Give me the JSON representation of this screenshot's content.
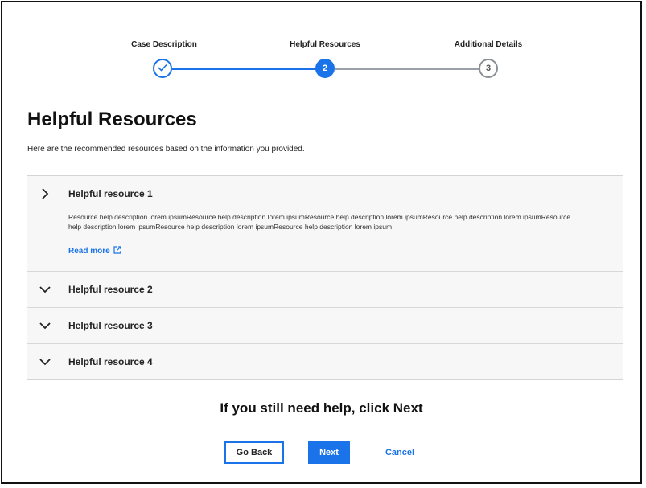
{
  "stepper": {
    "steps": [
      {
        "label": "Case Description",
        "state": "complete",
        "icon": "check-icon"
      },
      {
        "label": "Helpful Resources",
        "state": "active",
        "number": "2"
      },
      {
        "label": "Additional Details",
        "state": "upcoming",
        "number": "3"
      }
    ]
  },
  "page": {
    "title": "Helpful Resources",
    "intro": "Here are the recommended resources based on the information you provided."
  },
  "accordion": {
    "items": [
      {
        "title": "Helpful resource 1",
        "expanded": true,
        "chevron": "chevron-right-icon",
        "description": "Resource help description lorem ipsumResource help description lorem ipsumResource help description lorem ipsumResource help description lorem ipsumResource help description lorem ipsumResource help description lorem ipsumResource help description lorem ipsum",
        "read_more": "Read more",
        "read_more_icon": "external-link-icon"
      },
      {
        "title": "Helpful resource 2",
        "expanded": false,
        "chevron": "chevron-down-icon"
      },
      {
        "title": "Helpful resource 3",
        "expanded": false,
        "chevron": "chevron-down-icon"
      },
      {
        "title": "Helpful resource 4",
        "expanded": false,
        "chevron": "chevron-down-icon"
      }
    ]
  },
  "footer": {
    "cta": "If you still need help, click Next",
    "back_label": "Go Back",
    "next_label": "Next",
    "cancel_label": "Cancel"
  },
  "colors": {
    "accent": "#1a73e8",
    "inactive": "#9aa0a6"
  }
}
